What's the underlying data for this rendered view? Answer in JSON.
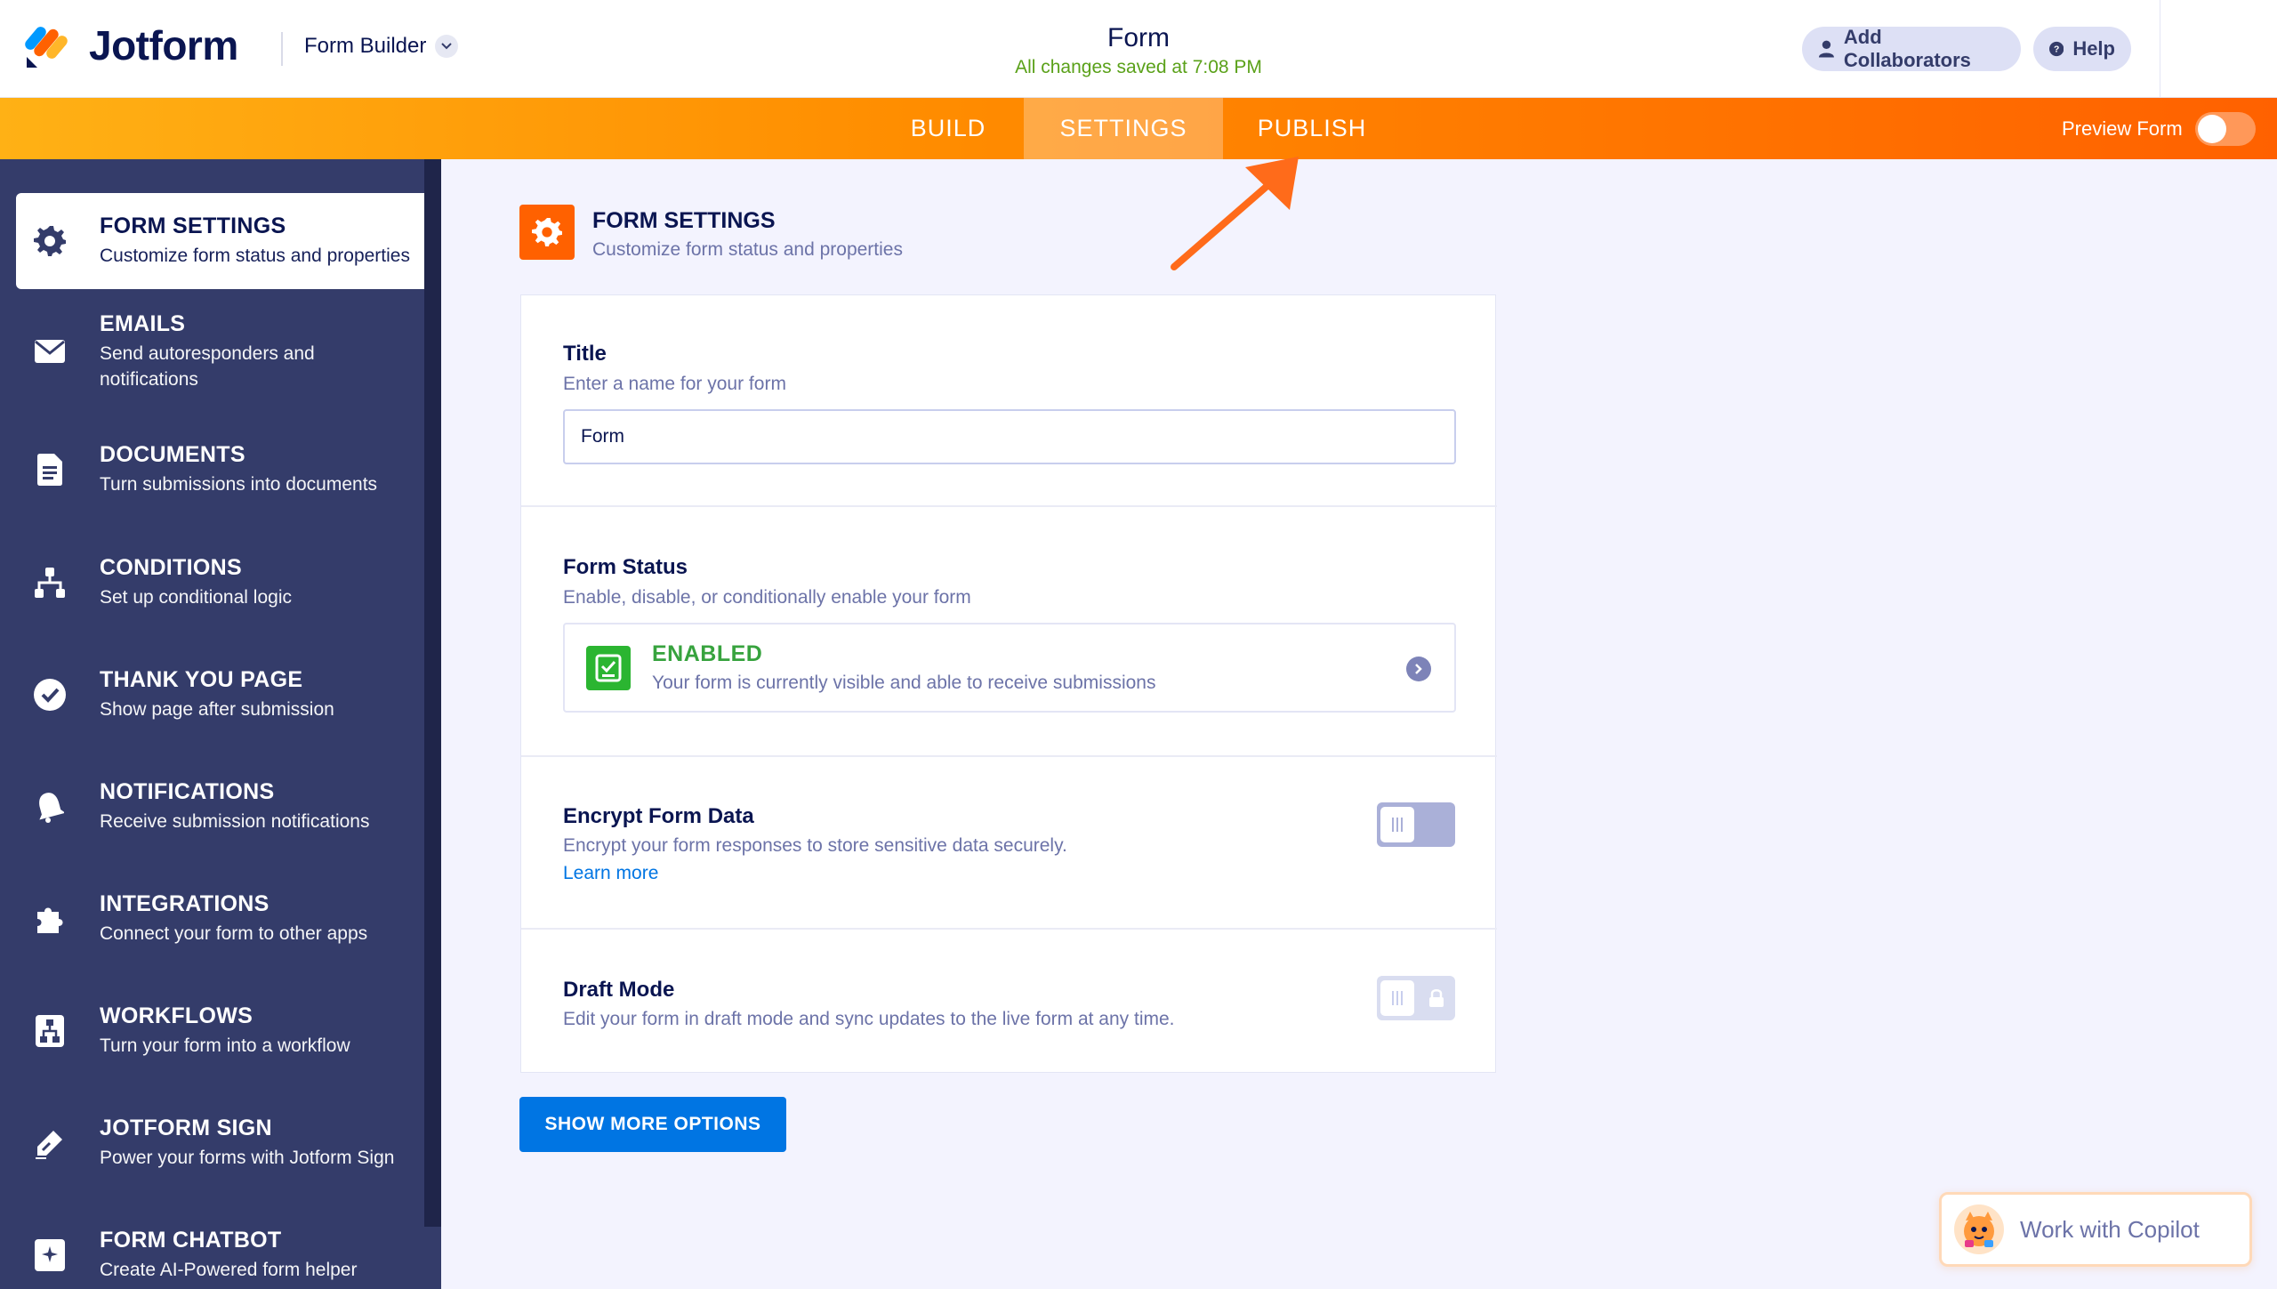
{
  "header": {
    "brand": "Jotform",
    "builder_menu": "Form Builder",
    "form_title": "Form",
    "save_status": "All changes saved at 7:08 PM",
    "add_collaborators": "Add Collaborators",
    "help": "Help"
  },
  "nav": {
    "tabs": [
      {
        "label": "BUILD"
      },
      {
        "label": "SETTINGS",
        "active": true
      },
      {
        "label": "PUBLISH"
      }
    ],
    "preview_label": "Preview Form"
  },
  "sidebar": {
    "items": [
      {
        "title": "FORM SETTINGS",
        "desc": "Customize form status and properties",
        "icon": "gear-icon",
        "active": true
      },
      {
        "title": "EMAILS",
        "desc": "Send autoresponders and notifications",
        "icon": "envelope-icon"
      },
      {
        "title": "DOCUMENTS",
        "desc": "Turn submissions into documents",
        "icon": "document-icon"
      },
      {
        "title": "CONDITIONS",
        "desc": "Set up conditional logic",
        "icon": "hierarchy-icon"
      },
      {
        "title": "THANK YOU PAGE",
        "desc": "Show page after submission",
        "icon": "check-circle-icon"
      },
      {
        "title": "NOTIFICATIONS",
        "desc": "Receive submission notifications",
        "icon": "bell-icon"
      },
      {
        "title": "INTEGRATIONS",
        "desc": "Connect your form to other apps",
        "icon": "puzzle-icon"
      },
      {
        "title": "WORKFLOWS",
        "desc": "Turn your form into a workflow",
        "icon": "workflow-icon"
      },
      {
        "title": "JOTFORM SIGN",
        "desc": "Power your forms with Jotform Sign",
        "icon": "pen-icon"
      },
      {
        "title": "FORM CHATBOT",
        "desc": "Create AI-Powered form helper",
        "icon": "chatbot-icon"
      }
    ]
  },
  "main": {
    "section_title": "FORM SETTINGS",
    "section_desc": "Customize form status and properties",
    "title_field": {
      "label": "Title",
      "desc": "Enter a name for your form",
      "value": "Form"
    },
    "form_status": {
      "label": "Form Status",
      "desc": "Enable, disable, or conditionally enable your form",
      "status": "ENABLED",
      "status_desc": "Your form is currently visible and able to receive submissions"
    },
    "encrypt": {
      "label": "Encrypt Form Data",
      "desc": "Encrypt your form responses to store sensitive data securely.",
      "link": "Learn more"
    },
    "draft": {
      "label": "Draft Mode",
      "desc": "Edit your form in draft mode and sync updates to the live form at any time."
    },
    "show_more": "SHOW MORE OPTIONS"
  },
  "copilot": {
    "label": "Work with Copilot"
  },
  "colors": {
    "accent": "#ff6100",
    "sidebar": "#343c6a",
    "primary_button": "#0075e3",
    "enabled_green": "#2bb531"
  }
}
